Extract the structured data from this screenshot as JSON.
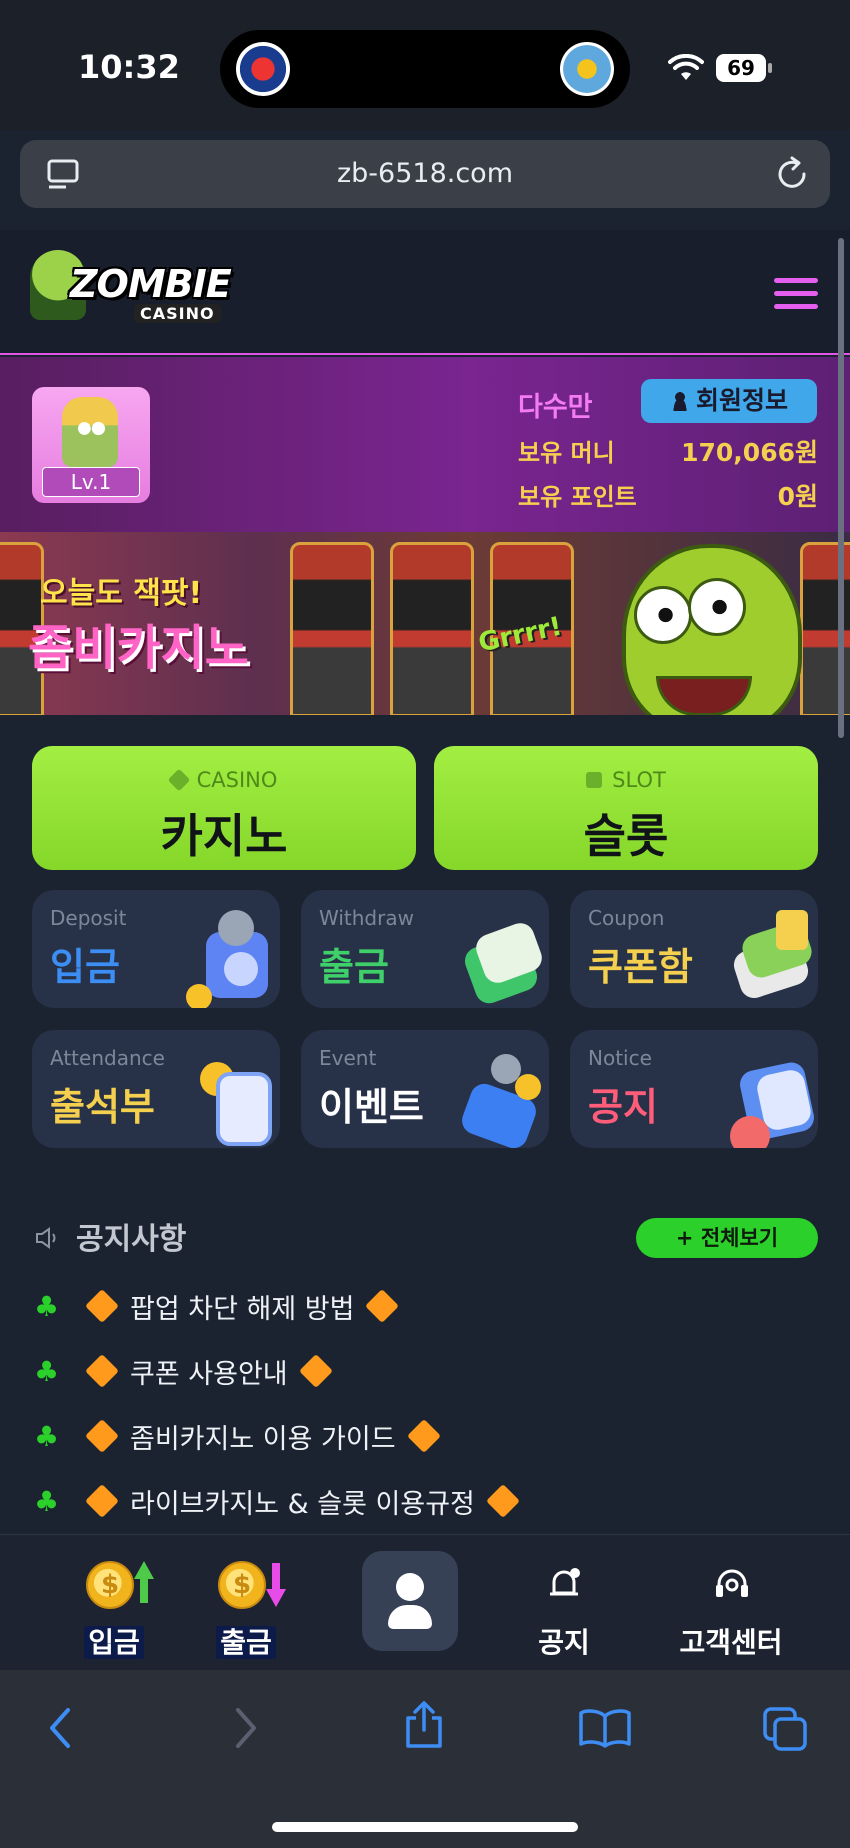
{
  "status_bar": {
    "time": "10:32",
    "battery": "69"
  },
  "browser": {
    "url": "zb-6518.com"
  },
  "site": {
    "logo_text": "ZOMBIE",
    "logo_sub": "CASINO"
  },
  "user": {
    "name": "다수만",
    "level": "Lv.1",
    "info_button": "회원정보",
    "money_label": "보유 머니",
    "money_value": "170,066원",
    "points_label": "보유 포인트",
    "points_value": "0원"
  },
  "banner": {
    "line1": "오늘도 잭팟!",
    "line2": "좀비카지노",
    "sound": "Grrrr!"
  },
  "games": [
    {
      "en": "CASINO",
      "ko": "카지노"
    },
    {
      "en": "SLOT",
      "ko": "슬롯"
    }
  ],
  "tiles": [
    {
      "en": "Deposit",
      "ko": "입금",
      "color": "#3c8ef5"
    },
    {
      "en": "Withdraw",
      "ko": "출금",
      "color": "#3fd06a"
    },
    {
      "en": "Coupon",
      "ko": "쿠폰함",
      "color": "#f4d04e"
    },
    {
      "en": "Attendance",
      "ko": "출석부",
      "color": "#f4d04e"
    },
    {
      "en": "Event",
      "ko": "이벤트",
      "color": "#ffffff"
    },
    {
      "en": "Notice",
      "ko": "공지",
      "color": "#ff5d7a"
    }
  ],
  "notices": {
    "title": "공지사항",
    "view_all": "+ 전체보기",
    "items": [
      "팝업 차단 해제 방법",
      "쿠폰 사용안내",
      "좀비카지노 이용 가이드",
      "라이브카지노 & 슬롯 이용규정"
    ]
  },
  "tabbar": {
    "deposit": "입금",
    "withdraw": "출금",
    "notice": "공지",
    "support": "고객센터"
  },
  "colors": {
    "accent_pink": "#e254e8",
    "accent_green": "#a3ee42",
    "gold": "#f4d04e"
  }
}
